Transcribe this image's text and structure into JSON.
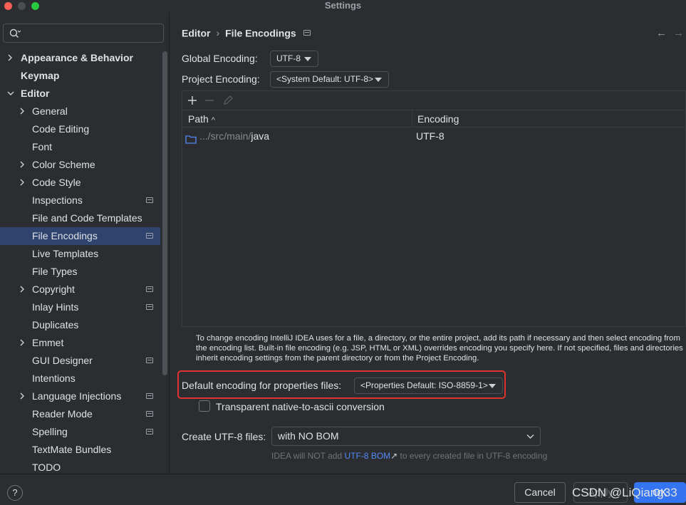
{
  "window": {
    "title": "Settings"
  },
  "search": {
    "value": "",
    "placeholder": ""
  },
  "sidebar": {
    "items": [
      {
        "label": "Appearance & Behavior"
      },
      {
        "label": "Keymap"
      },
      {
        "label": "Editor"
      },
      {
        "label": "General"
      },
      {
        "label": "Code Editing"
      },
      {
        "label": "Font"
      },
      {
        "label": "Color Scheme"
      },
      {
        "label": "Code Style"
      },
      {
        "label": "Inspections"
      },
      {
        "label": "File and Code Templates"
      },
      {
        "label": "File Encodings"
      },
      {
        "label": "Live Templates"
      },
      {
        "label": "File Types"
      },
      {
        "label": "Copyright"
      },
      {
        "label": "Inlay Hints"
      },
      {
        "label": "Duplicates"
      },
      {
        "label": "Emmet"
      },
      {
        "label": "GUI Designer"
      },
      {
        "label": "Intentions"
      },
      {
        "label": "Language Injections"
      },
      {
        "label": "Reader Mode"
      },
      {
        "label": "Spelling"
      },
      {
        "label": "TextMate Bundles"
      },
      {
        "label": "TODO"
      }
    ]
  },
  "breadcrumb": {
    "parent": "Editor",
    "separator": "›",
    "current": "File Encodings"
  },
  "nav": {
    "back": "←",
    "forward": "→"
  },
  "global_encoding": {
    "label": "Global Encoding:",
    "value": "UTF-8"
  },
  "project_encoding": {
    "label": "Project Encoding:",
    "value": "<System Default: UTF-8>"
  },
  "table": {
    "columns": {
      "path": "Path",
      "sort_indicator": "^",
      "encoding": "Encoding"
    },
    "rows": [
      {
        "path_prefix": ".../src/main/",
        "path_name": "java",
        "encoding": "UTF-8"
      }
    ]
  },
  "help_text": "To change encoding IntelliJ IDEA uses for a file, a directory, or the entire project, add its path if necessary and then select encoding from the encoding list. Built-in file encoding (e.g. JSP, HTML or XML) overrides encoding you specify here. If not specified, files and directories inherit encoding settings from the parent directory or from the Project Encoding.",
  "properties_encoding": {
    "label": "Default encoding for properties files:",
    "value": "<Properties Default: ISO-8859-1>"
  },
  "native_to_ascii": {
    "label": "Transparent native-to-ascii conversion",
    "checked": false
  },
  "utf8_files": {
    "label": "Create UTF-8 files:",
    "value": "with NO BOM"
  },
  "bom_note": {
    "before": "IDEA will NOT add ",
    "link": "UTF-8 BOM",
    "arrow": "↗",
    "after": " to every created file in UTF-8 encoding"
  },
  "buttons": {
    "help": "?",
    "cancel": "Cancel",
    "apply": "Apply",
    "ok": "OK"
  },
  "watermark": "CSDN @LiQiang33",
  "colors": {
    "selection": "#2e436e",
    "highlight": "#e0322d",
    "primary": "#3574f0",
    "link": "#548af7",
    "folder": "#548af7"
  }
}
